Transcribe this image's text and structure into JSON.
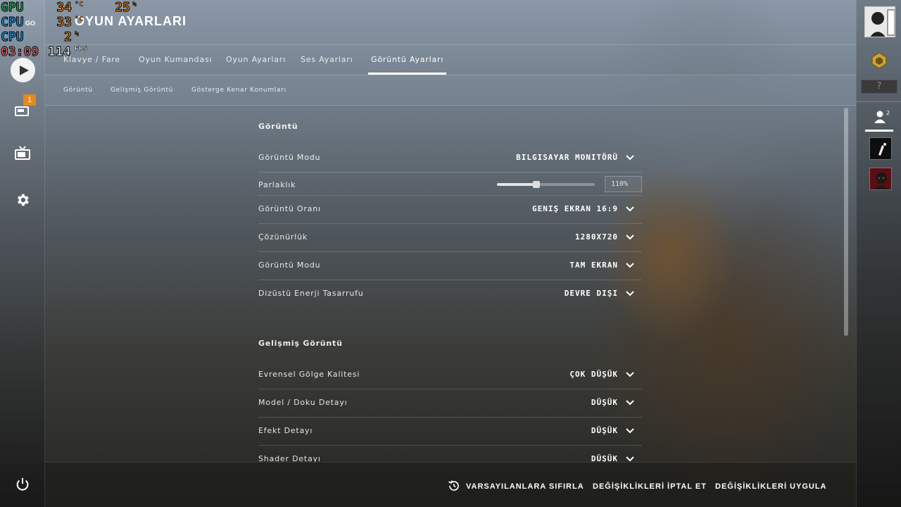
{
  "overlay": {
    "gpu_label": "GPU",
    "cpu_label": "CPU",
    "cpu2_label": "CPU",
    "clock": "03:09",
    "gpu_temp": "34",
    "cpu_temp": "33",
    "temp_unit": "°C",
    "gpu_load": "25",
    "cpu_load": "2",
    "load_unit": "%",
    "fps": "114",
    "fps_unit": "FPS",
    "version_label": "GO"
  },
  "header": {
    "title": "OYUN AYARLARI"
  },
  "left_rail": {
    "badge_count": "1"
  },
  "tabs": [
    {
      "label": "Klavye / Fare"
    },
    {
      "label": "Oyun Kumandası"
    },
    {
      "label": "Oyun Ayarları"
    },
    {
      "label": "Ses Ayarları"
    },
    {
      "label": "Görüntü Ayarları"
    }
  ],
  "subtabs": [
    {
      "label": "Görüntü"
    },
    {
      "label": "Gelişmiş Görüntü"
    },
    {
      "label": "Gösterge Kenar Konumları"
    }
  ],
  "sections": {
    "display_title": "Görüntü",
    "advanced_title": "Gelişmiş Görüntü"
  },
  "display_rows": [
    {
      "label": "Görüntü Modu",
      "value": "BILGISAYAR MONITÖRÜ"
    },
    {
      "label": "Parlaklık",
      "value": "110%",
      "slider_fraction": 0.4
    },
    {
      "label": "Görüntü Oranı",
      "value": "GENIŞ EKRAN 16:9"
    },
    {
      "label": "Çözünürlük",
      "value": "1280X720"
    },
    {
      "label": "Görüntü Modu",
      "value": "TAM EKRAN"
    },
    {
      "label": "Dizüstü Enerji Tasarrufu",
      "value": "DEVRE DIŞI"
    }
  ],
  "advanced_rows": [
    {
      "label": "Evrensel Gölge Kalitesi",
      "value": "ÇOK DÜŞÜK"
    },
    {
      "label": "Model / Doku Detayı",
      "value": "DÜŞÜK"
    },
    {
      "label": "Efekt Detayı",
      "value": "DÜŞÜK"
    },
    {
      "label": "Shader Detayı",
      "value": "DÜŞÜK"
    }
  ],
  "footer": {
    "reset_label": "VARSAYILANLARA SIFIRLA",
    "cancel_label": "DEĞİŞİKLİKLERİ İPTAL ET",
    "apply_label": "DEĞİŞİKLİKLERİ UYGULA"
  },
  "right_rail": {
    "unknown_rank_label": "?",
    "friends_count": "2"
  }
}
